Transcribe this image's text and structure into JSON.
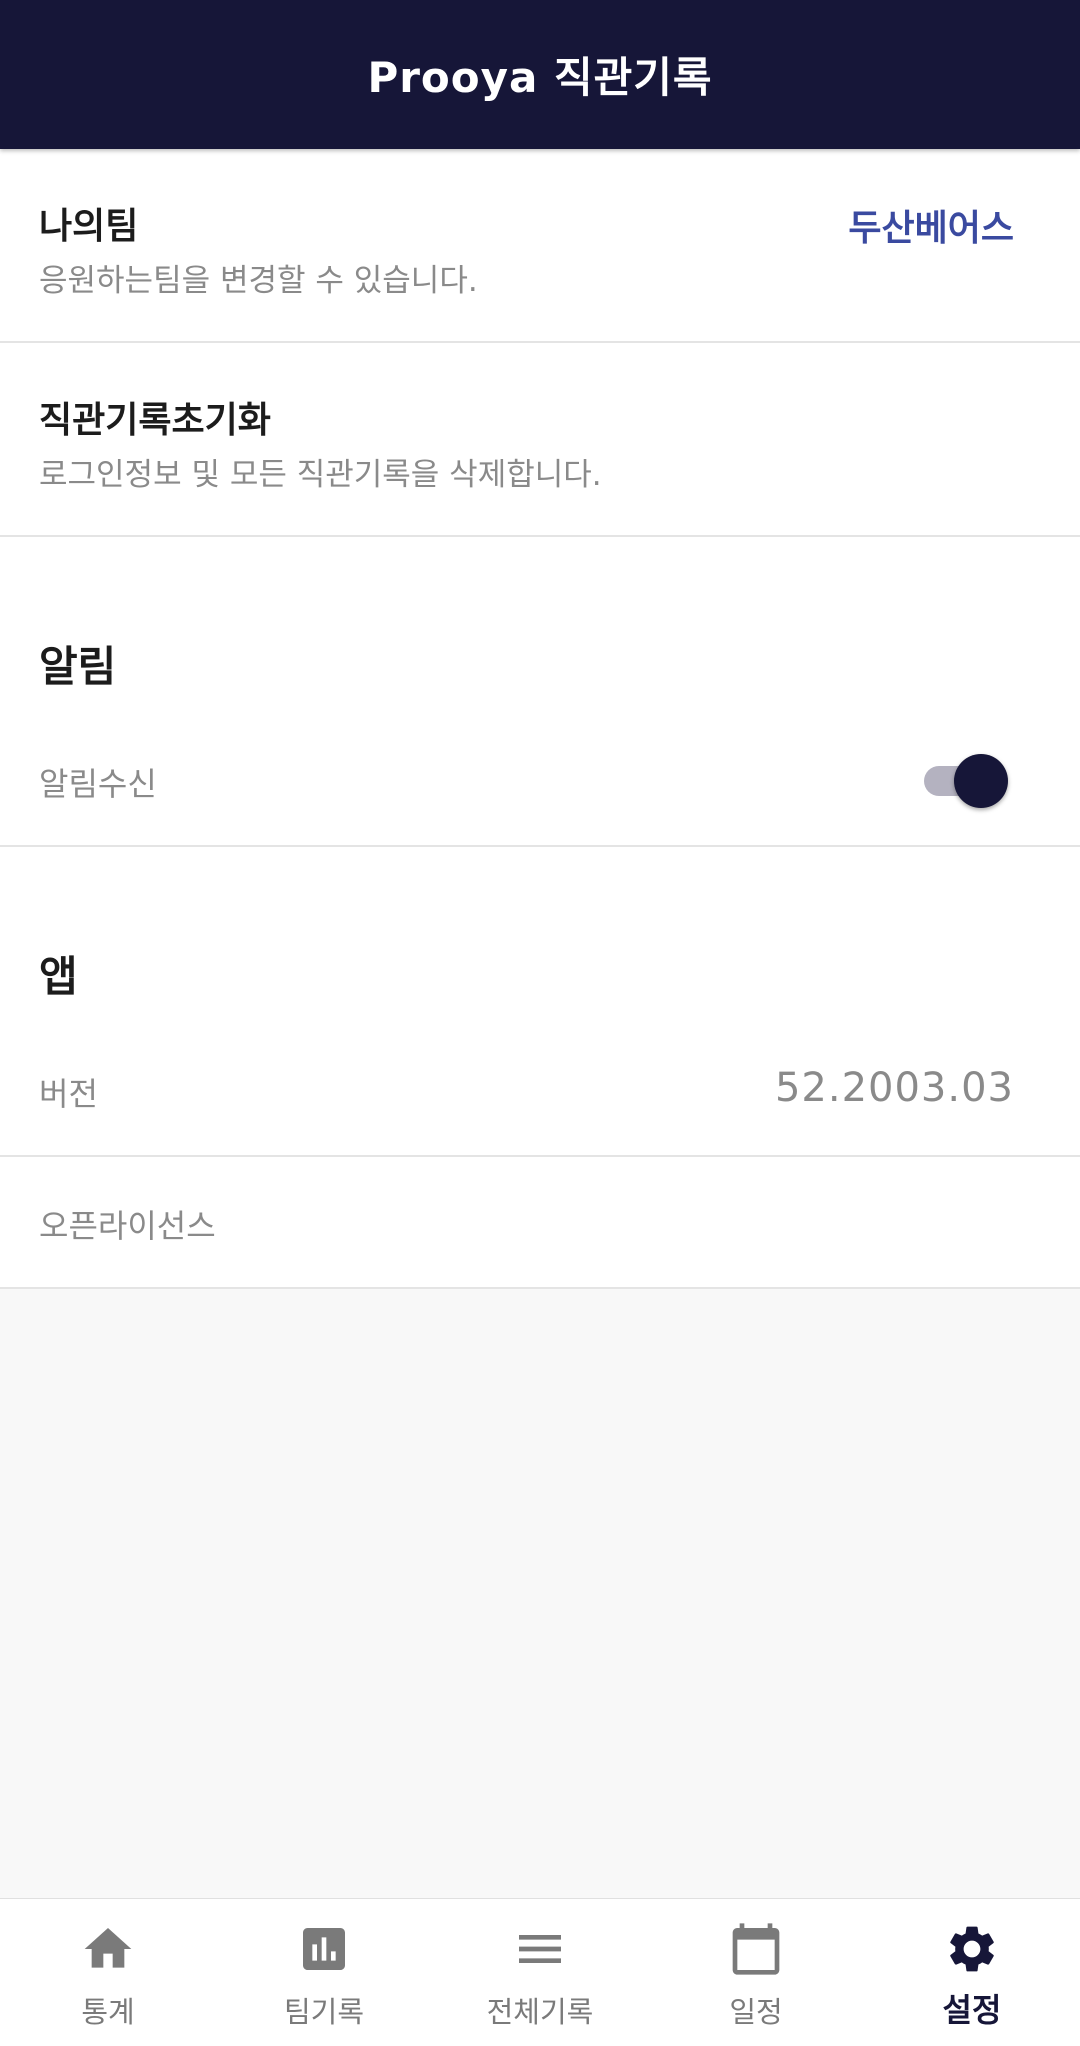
{
  "app": {
    "title": "Prooya 직관기록"
  },
  "settings": {
    "my_team": {
      "title": "나의팀",
      "subtitle": "응원하는팀을 변경할 수 있습니다.",
      "value": "두산베어스"
    },
    "reset": {
      "title": "직관기록초기화",
      "subtitle": "로그인정보 및 모든 직관기록을 삭제합니다."
    },
    "notifications": {
      "header": "알림",
      "receive_label": "알림수신",
      "receive_enabled": true
    },
    "app_section": {
      "header": "앱",
      "version_label": "버전",
      "version_value": "52.2003.03",
      "license_label": "오픈라이선스"
    }
  },
  "bottom_nav": {
    "items": [
      {
        "label": "통계",
        "icon": "home-icon",
        "active": false
      },
      {
        "label": "팀기록",
        "icon": "bar-chart-icon",
        "active": false
      },
      {
        "label": "전체기록",
        "icon": "menu-icon",
        "active": false
      },
      {
        "label": "일정",
        "icon": "calendar-icon",
        "active": false
      },
      {
        "label": "설정",
        "icon": "gear-icon",
        "active": true
      }
    ]
  },
  "colors": {
    "primary": "#161638",
    "link": "#3a4aa0",
    "background": "#f8f8f8"
  }
}
